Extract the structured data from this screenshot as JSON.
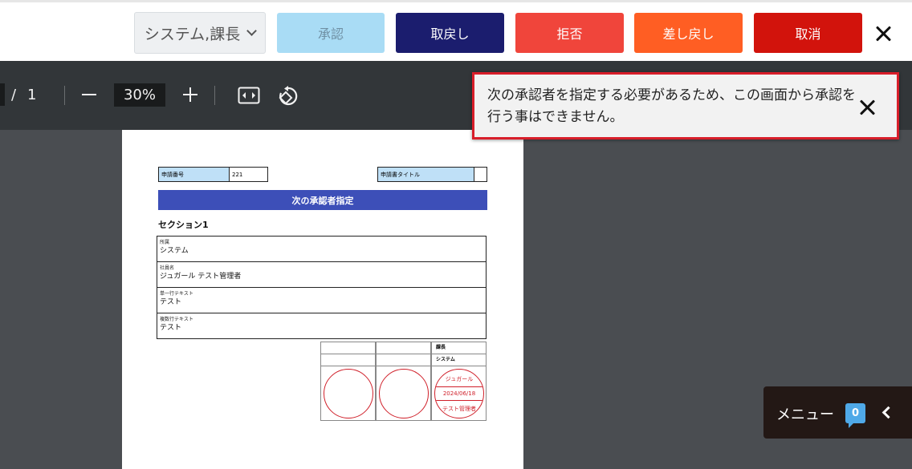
{
  "header": {
    "role_select": "システム,課長",
    "buttons": {
      "approve": "承認",
      "withdraw": "取戻し",
      "reject": "拒否",
      "send_back": "差し戻し",
      "cancel": "取消"
    }
  },
  "viewer": {
    "page_separator": "/",
    "page_total": "1",
    "zoom": "30%"
  },
  "document": {
    "app_number_label": "申請番号",
    "app_number_value": "221",
    "app_title_label": "申請書タイトル",
    "app_title_value": "",
    "title": "次の承認者指定",
    "section": "セクション1",
    "fields": [
      {
        "label": "所属",
        "value": "システム"
      },
      {
        "label": "社員名",
        "value": "ジュガール テスト管理者"
      },
      {
        "label": "単一行テキスト",
        "value": "テスト"
      },
      {
        "label": "複数行テキスト",
        "value": "テスト"
      }
    ],
    "stamp": {
      "position": "課長",
      "department": "システム",
      "seal_top": "ジュガール",
      "seal_date": "2024/06/18",
      "seal_bottom": "テスト管理者"
    }
  },
  "notification": {
    "message": "次の承認者を指定する必要があるため、この画面から承認を行う事はできません。"
  },
  "menu": {
    "label": "メニュー",
    "badge": "0"
  },
  "colors": {
    "approve": "#a9dcf5",
    "withdraw": "#1b1d6e",
    "reject": "#f0453b",
    "send_back": "#ff5e23",
    "cancel": "#d2130c",
    "title_band": "#3d4fb8",
    "alert_border": "#d81e2a",
    "seal": "#d0202a"
  }
}
